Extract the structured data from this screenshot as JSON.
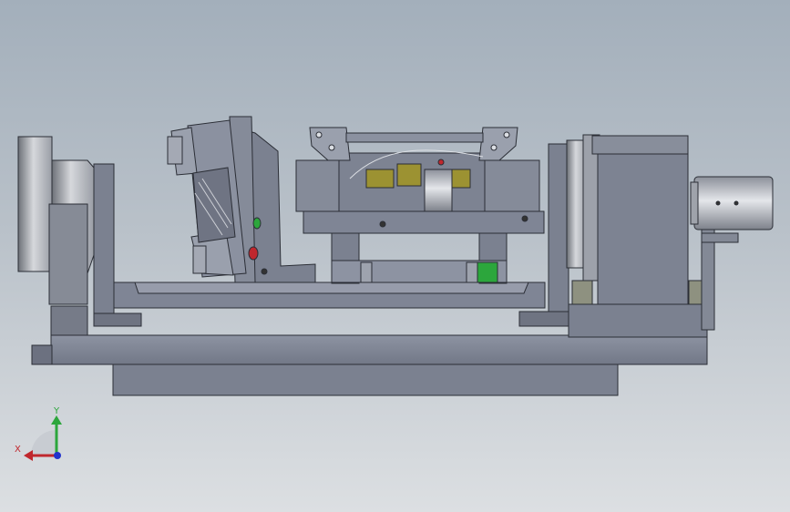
{
  "viewport": {
    "background_top": "#a3afbb",
    "background_bottom": "#dcdfe2",
    "model_color": "#7b8190",
    "accent_yellow": "#9c9232",
    "accent_green": "#2ca63c",
    "accent_red": "#c0272d"
  },
  "triad": {
    "x_label": "X",
    "y_label": "Y",
    "x_color": "#c0272d",
    "y_color": "#2ca63c",
    "z_color": "#2233cc",
    "icon": "coordinate-triad-icon"
  }
}
